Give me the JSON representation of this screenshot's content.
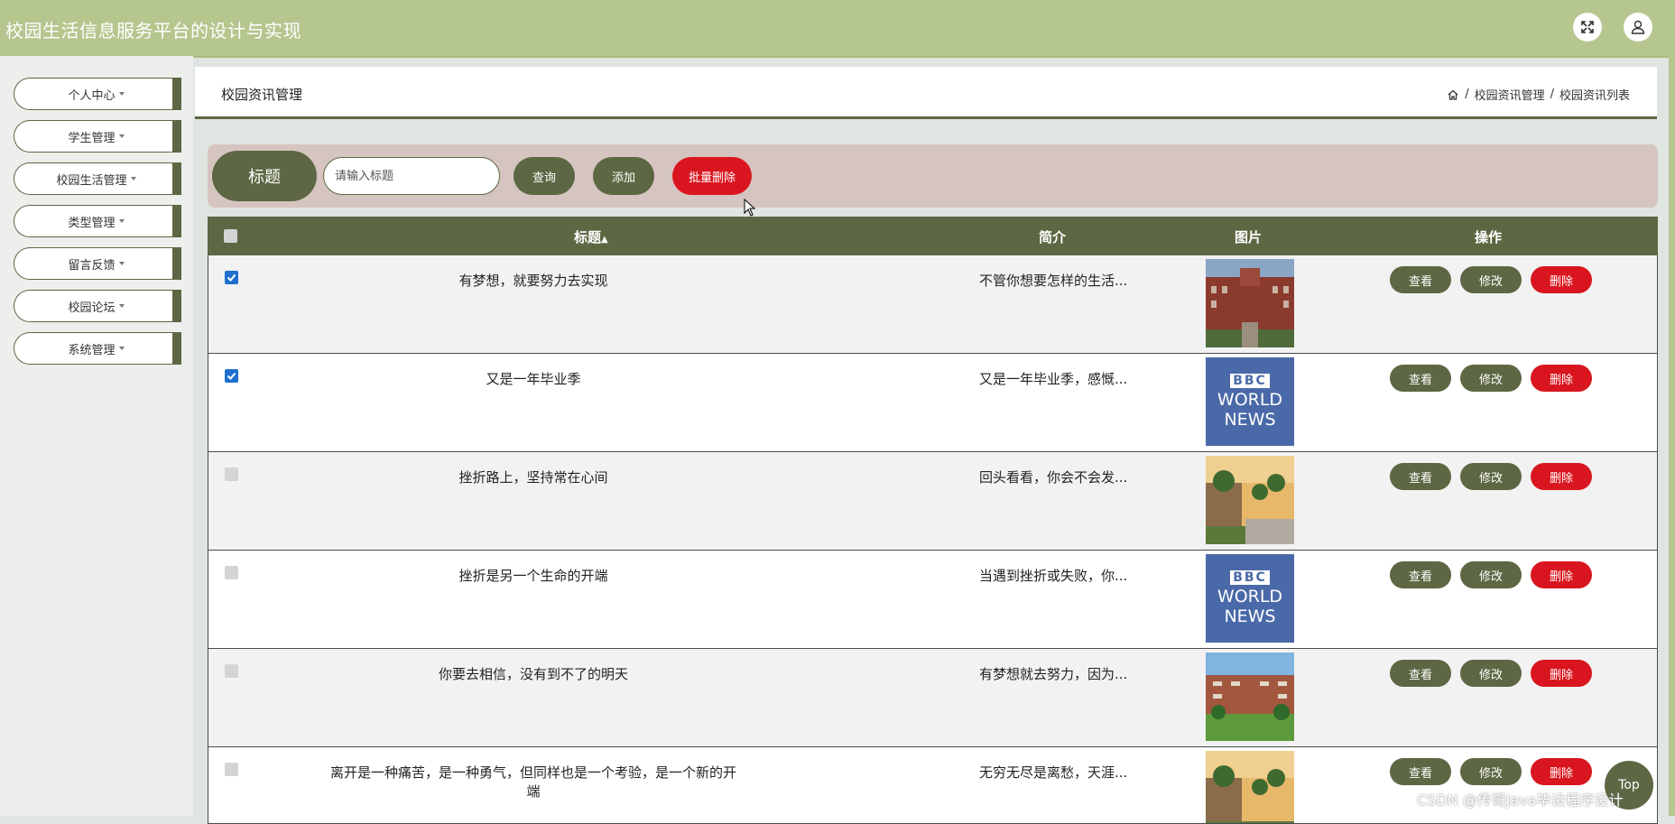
{
  "header": {
    "title": "校园生活信息服务平台的设计与实现",
    "fullscreen_icon": "expand-icon",
    "user_icon": "user-icon"
  },
  "sidebar": {
    "items": [
      {
        "label": "个人中心"
      },
      {
        "label": "学生管理"
      },
      {
        "label": "校园生活管理"
      },
      {
        "label": "类型管理"
      },
      {
        "label": "留言反馈"
      },
      {
        "label": "校园论坛"
      },
      {
        "label": "系统管理"
      }
    ]
  },
  "main": {
    "page_title": "校园资讯管理",
    "breadcrumb": [
      "校园资讯管理",
      "校园资讯列表"
    ]
  },
  "search": {
    "label": "标题",
    "placeholder": "请输入标题",
    "query_button": "查询",
    "add_button": "添加",
    "batch_delete_button": "批量删除"
  },
  "table": {
    "headers": {
      "title": "标题",
      "intro": "简介",
      "image": "图片",
      "actions": "操作"
    },
    "row_actions": {
      "view": "查看",
      "edit": "修改",
      "delete": "删除"
    },
    "rows": [
      {
        "checked": true,
        "title": "有梦想，就要努力去实现",
        "intro": "不管你想要怎样的生活...",
        "image": "campus-building"
      },
      {
        "checked": true,
        "title": "又是一年毕业季",
        "intro": "又是一年毕业季，感慨...",
        "image": "bbc-world-news"
      },
      {
        "checked": false,
        "title": "挫折路上，坚持常在心间",
        "intro": "回头看看，你会不会发...",
        "image": "campus-sunset"
      },
      {
        "checked": false,
        "title": "挫折是另一个生命的开端",
        "intro": "当遇到挫折或失败，你...",
        "image": "bbc-world-news"
      },
      {
        "checked": false,
        "title": "你要去相信，没有到不了的明天",
        "intro": "有梦想就去努力，因为...",
        "image": "campus-garden"
      },
      {
        "checked": false,
        "title": "离开是一种痛苦，是一种勇气，但同样也是一个考验，是一个新的开端",
        "intro": "无穷无尽是离愁，天涯...",
        "image": "campus-sunset"
      }
    ],
    "bbc_logo": {
      "line1": "BBC",
      "line2": "WORLD",
      "line3": "NEWS"
    }
  },
  "back_to_top": "Top",
  "watermark": "CSDN @传哥Java毕设程序设计",
  "colors": {
    "primary": "#5d6743",
    "header": "#b6c68f",
    "danger": "#d9161f",
    "search_bg": "#d6c4c1"
  }
}
